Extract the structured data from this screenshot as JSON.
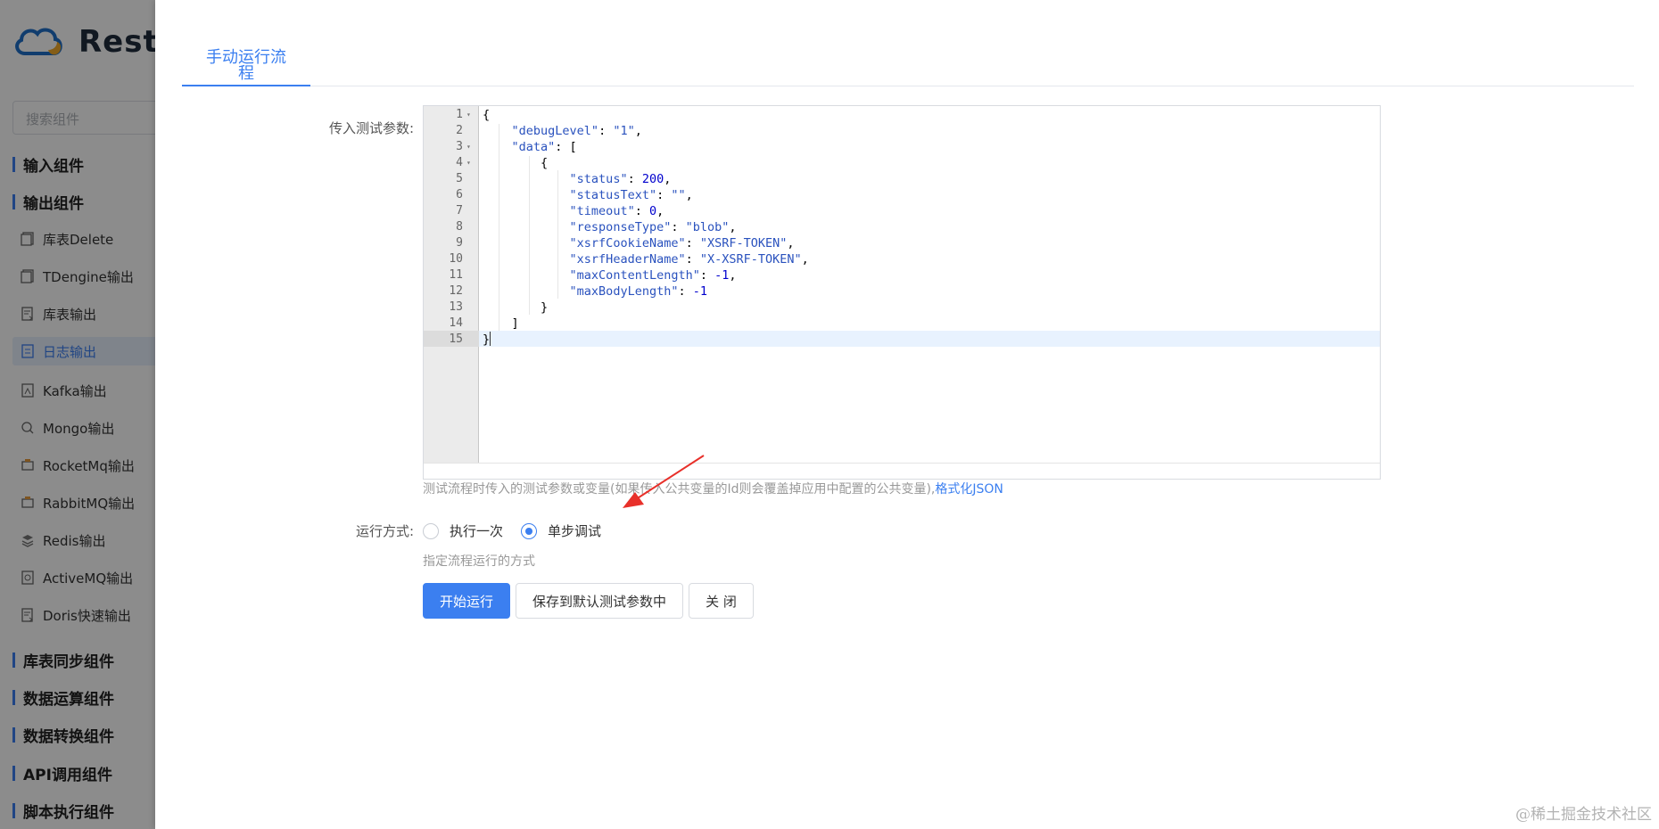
{
  "sidebar": {
    "logo_text": "Rest",
    "search_placeholder": "搜索组件",
    "groups_top": [
      "输入组件",
      "输出组件"
    ],
    "items": [
      {
        "label": "库表Delete",
        "icon": "table-delete-icon"
      },
      {
        "label": "TDengine输出",
        "icon": "table-icon"
      },
      {
        "label": "库表输出",
        "icon": "table-output-icon"
      },
      {
        "label": "日志输出",
        "icon": "log-icon",
        "active": true
      },
      {
        "label": "Kafka输出",
        "icon": "kafka-icon"
      },
      {
        "label": "Mongo输出",
        "icon": "mongo-icon"
      },
      {
        "label": "RocketMq输出",
        "icon": "rocketmq-icon"
      },
      {
        "label": "RabbitMQ输出",
        "icon": "rabbitmq-icon"
      },
      {
        "label": "Redis输出",
        "icon": "redis-icon"
      },
      {
        "label": "ActiveMQ输出",
        "icon": "activemq-icon"
      },
      {
        "label": "Doris快速输出",
        "icon": "doris-icon"
      }
    ],
    "groups_bottom": [
      "库表同步组件",
      "数据运算组件",
      "数据转换组件",
      "API调用组件",
      "脚本执行组件"
    ]
  },
  "dialog": {
    "tab_title": "手动运行流程",
    "params_label": "传入测试参数:",
    "editor": {
      "active_line": 15,
      "lines": [
        "{",
        "    \"debugLevel\": \"1\",",
        "    \"data\": [",
        "        {",
        "            \"status\": 200,",
        "            \"statusText\": \"\",",
        "            \"timeout\": 0,",
        "            \"responseType\": \"blob\",",
        "            \"xsrfCookieName\": \"XSRF-TOKEN\",",
        "            \"xsrfHeaderName\": \"X-XSRF-TOKEN\",",
        "            \"maxContentLength\": -1,",
        "            \"maxBodyLength\": -1",
        "        }",
        "    ]",
        "}"
      ],
      "foldable_lines": [
        1,
        3,
        4
      ]
    },
    "params_hint": "测试流程时传入的测试参数或变量(如果传入公共变量的Id则会覆盖掉应用中配置的公共变量),",
    "format_json_link": "格式化JSON",
    "run_mode_label": "运行方式:",
    "run_mode_options": [
      {
        "label": "执行一次",
        "checked": false
      },
      {
        "label": "单步调试",
        "checked": true
      }
    ],
    "run_mode_hint": "指定流程运行的方式",
    "buttons": {
      "start": "开始运行",
      "save_default": "保存到默认测试参数中",
      "close": "关 闭"
    }
  },
  "watermark": "@稀土掘金技术社区",
  "colors": {
    "accent": "#3b7ff0",
    "annotation_arrow": "#e8302a"
  }
}
